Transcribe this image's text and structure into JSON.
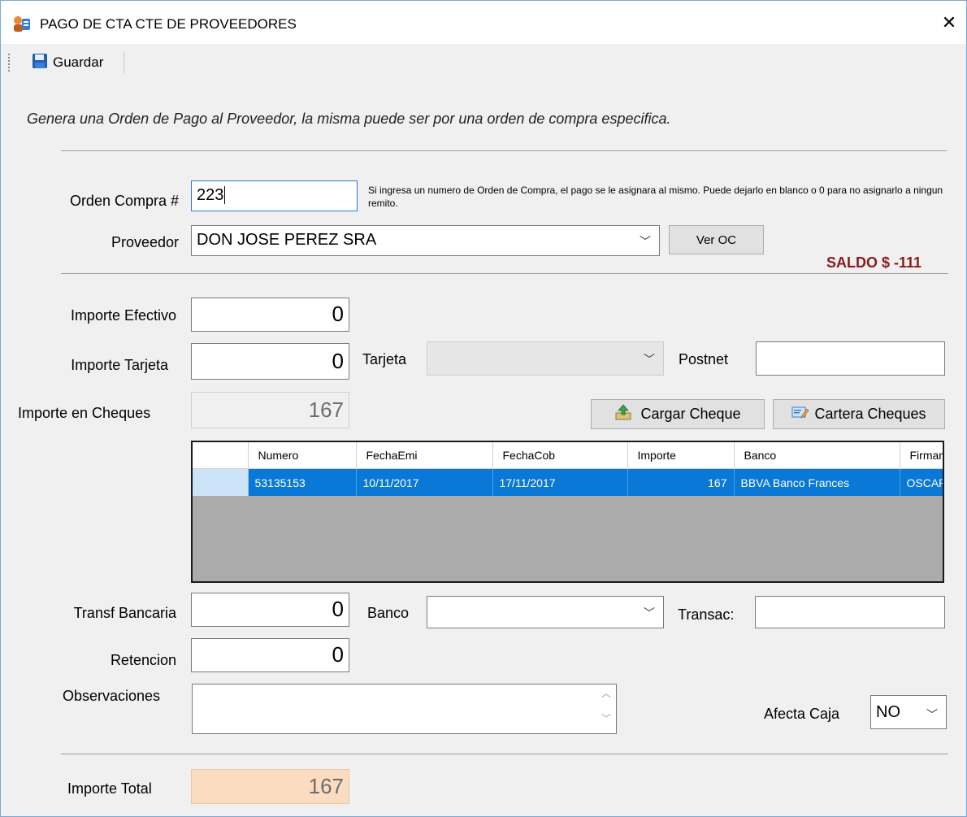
{
  "window": {
    "title": "PAGO DE CTA CTE DE PROVEEDORES",
    "close_glyph": "✕"
  },
  "toolbar": {
    "save_label": "Guardar"
  },
  "description": "Genera una Orden de Pago al Proveedor, la misma puede ser por una orden de compra especifica.",
  "orden_compra": {
    "label": "Orden Compra #",
    "value": "223",
    "hint": "Si ingresa un numero de Orden de Compra, el pago se le asignara al mismo. Puede dejarlo en blanco o 0 para no asignarlo a ningun remito."
  },
  "proveedor": {
    "label": "Proveedor",
    "value": "DON JOSE PEREZ SRA",
    "ver_oc_label": "Ver OC",
    "saldo": "SALDO $ -111"
  },
  "importe_efectivo": {
    "label": "Importe Efectivo",
    "value": "0"
  },
  "importe_tarjeta": {
    "label": "Importe Tarjeta",
    "value": "0"
  },
  "tarjeta": {
    "label": "Tarjeta",
    "value": ""
  },
  "postnet": {
    "label": "Postnet",
    "value": ""
  },
  "importe_cheques": {
    "label": "Importe en Cheques",
    "value": "167"
  },
  "cheques": {
    "cargar_label": "Cargar Cheque",
    "cartera_label": "Cartera Cheques",
    "columns": [
      "Numero",
      "FechaEmi",
      "FechaCob",
      "Importe",
      "Banco",
      "Firmant"
    ],
    "rows": [
      [
        "53135153",
        "10/11/2017",
        "17/11/2017",
        "167",
        "BBVA Banco Frances",
        "OSCAR"
      ]
    ]
  },
  "transf": {
    "label": "Transf Bancaria",
    "value": "0"
  },
  "banco": {
    "label": "Banco",
    "value": ""
  },
  "transac": {
    "label": "Transac:",
    "value": ""
  },
  "retencion": {
    "label": "Retencion",
    "value": "0"
  },
  "observaciones": {
    "label": "Observaciones",
    "value": ""
  },
  "afecta_caja": {
    "label": "Afecta Caja",
    "value": "NO"
  },
  "importe_total": {
    "label": "Importe Total",
    "value": "167"
  },
  "colors": {
    "accent": "#0a78d7",
    "saldo": "#8b1a1a",
    "total_bg": "#fbdcc0"
  }
}
